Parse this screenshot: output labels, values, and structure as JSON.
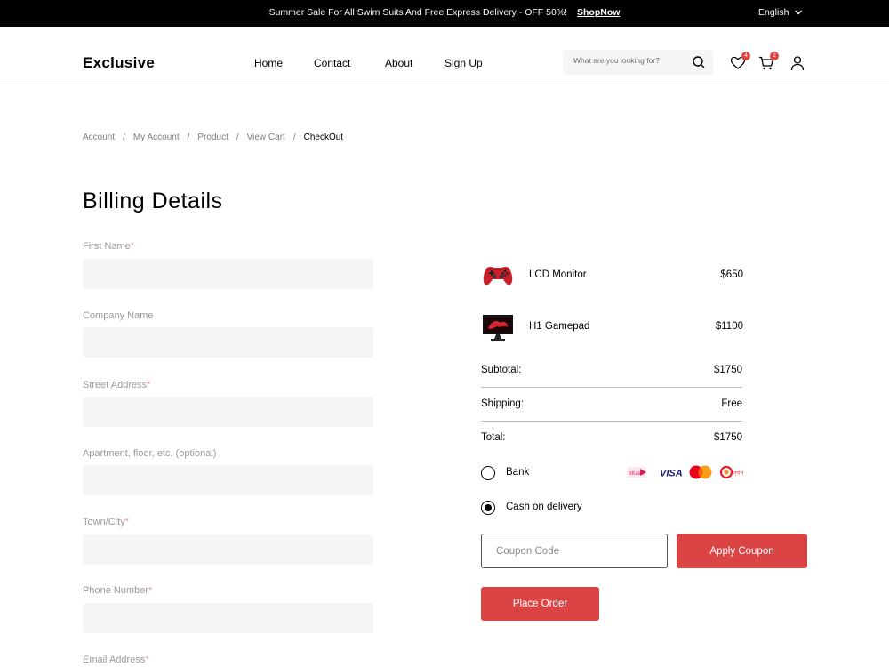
{
  "topbar": {
    "promo": "Summer Sale For All Swim Suits And Free Express Delivery - OFF 50%!",
    "shop_now": "ShopNow",
    "language": "English"
  },
  "header": {
    "logo": "Exclusive",
    "nav": [
      "Home",
      "Contact",
      "About",
      "Sign Up"
    ],
    "search_placeholder": "What are you looking for?",
    "wishlist_count": "4",
    "cart_count": "2"
  },
  "breadcrumb": {
    "items": [
      "Account",
      "My Account",
      "Product",
      "View Cart"
    ],
    "current": "CheckOut"
  },
  "billing": {
    "title": "Billing Details",
    "fields": [
      {
        "label": "First Name",
        "required": "*"
      },
      {
        "label": "Company Name",
        "required": ""
      },
      {
        "label": "Street Address",
        "required": "*"
      },
      {
        "label": "Apartment, floor, etc. (optional)",
        "required": ""
      },
      {
        "label": "Town/City",
        "required": "*"
      },
      {
        "label": "Phone Number",
        "required": "*"
      },
      {
        "label": "Email Address",
        "required": "*"
      }
    ]
  },
  "order": {
    "items": [
      {
        "name": "LCD Monitor",
        "price": "$650",
        "icon": "gamepad-image"
      },
      {
        "name": "H1 Gamepad",
        "price": "$1100",
        "icon": "monitor-image"
      }
    ],
    "subtotal_label": "Subtotal:",
    "subtotal": "$1750",
    "shipping_label": "Shipping:",
    "shipping": "Free",
    "total_label": "Total:",
    "total": "$1750",
    "payment_options": [
      {
        "label": "Bank",
        "selected": false
      },
      {
        "label": "Cash on delivery",
        "selected": true
      }
    ],
    "payment_logos": [
      "bkash",
      "VISA",
      "mastercard",
      "nagad"
    ],
    "coupon_placeholder": "Coupon Code",
    "apply_coupon": "Apply Coupon",
    "place_order": "Place Order"
  },
  "colors": {
    "accent": "#db4444",
    "input_bg": "#f5f5f5",
    "topbar_bg": "#000000"
  }
}
